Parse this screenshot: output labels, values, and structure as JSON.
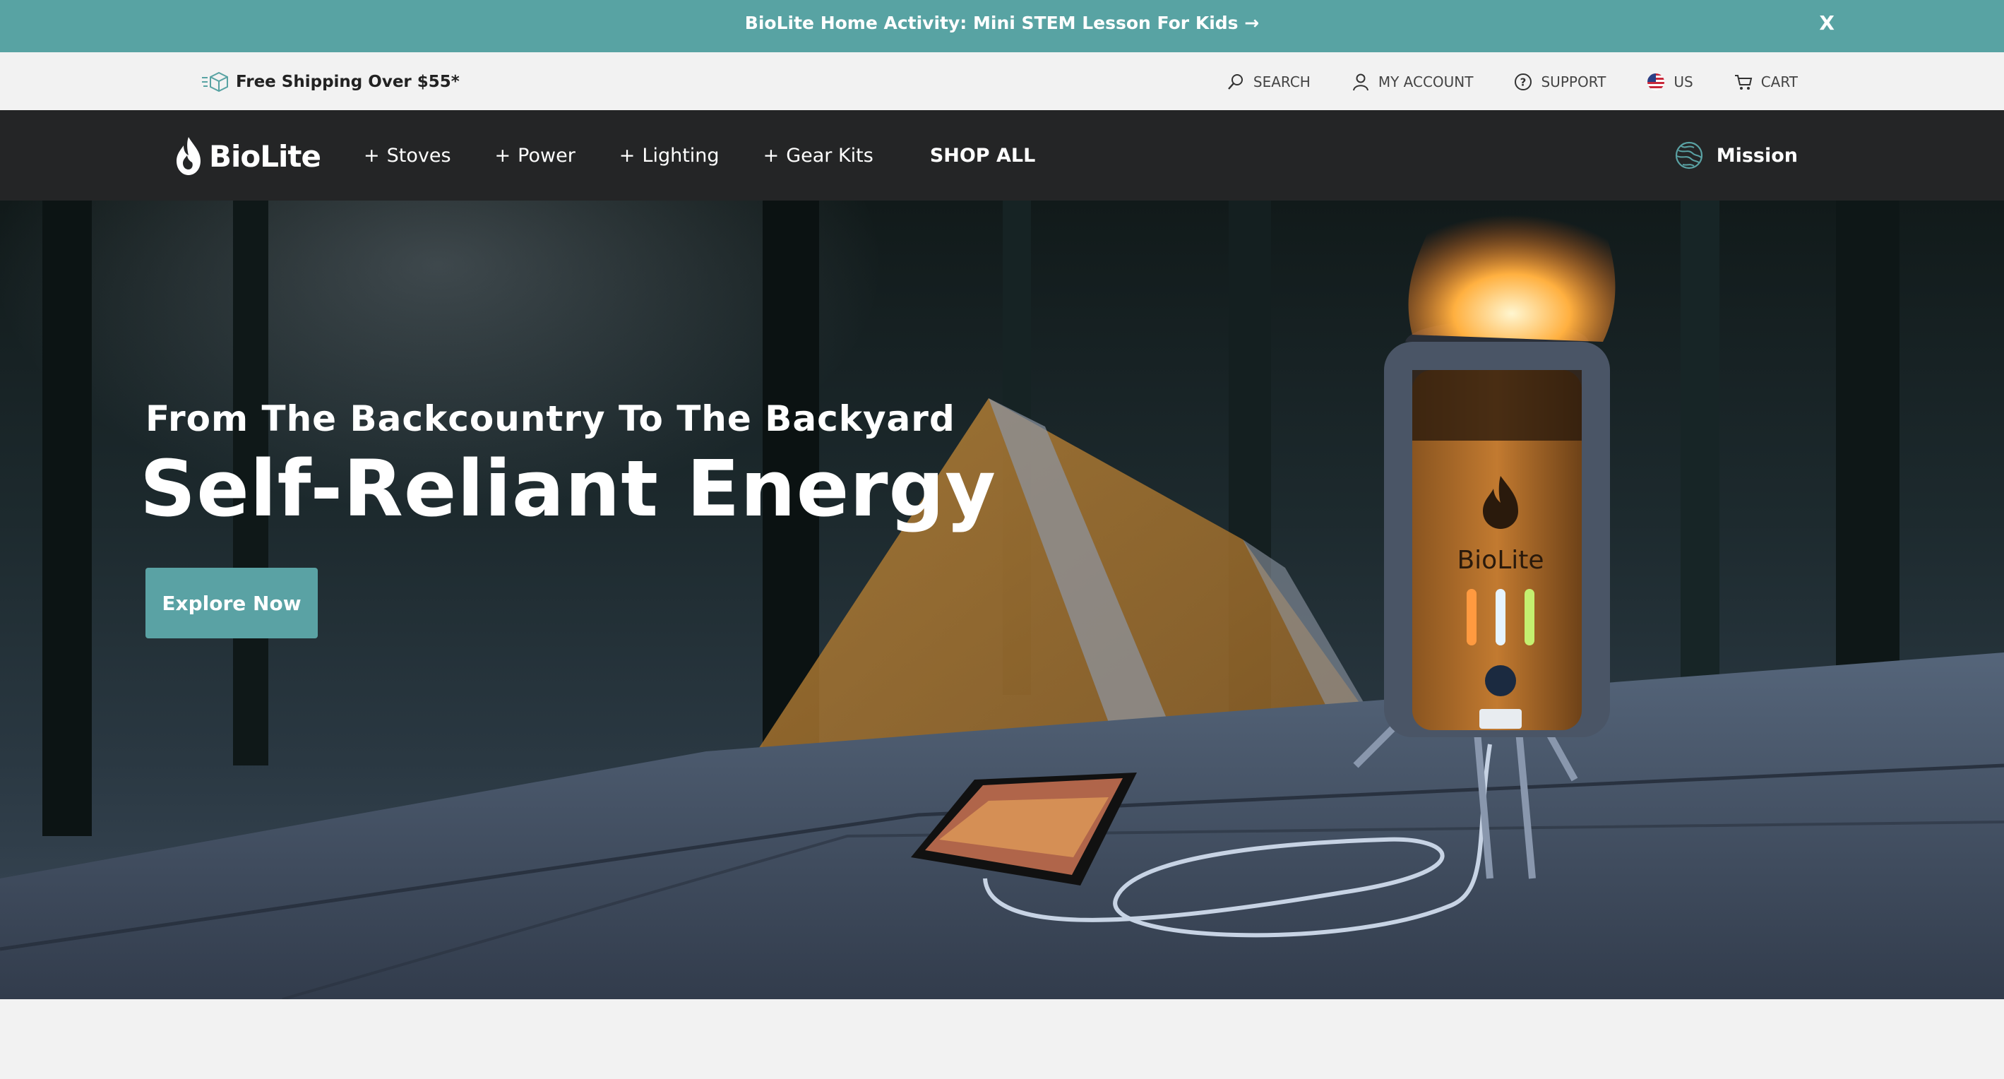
{
  "announcement": {
    "text": "BioLite Home Activity: Mini STEM Lesson For Kids →",
    "close_label": "X"
  },
  "utility": {
    "shipping_text": "Free Shipping Over $55*",
    "links": [
      {
        "label": "SEARCH",
        "icon": "search-icon"
      },
      {
        "label": "MY ACCOUNT",
        "icon": "user-icon"
      },
      {
        "label": "SUPPORT",
        "icon": "help-icon"
      },
      {
        "label": "US",
        "icon": "us-flag-icon"
      },
      {
        "label": "CART",
        "icon": "cart-icon"
      }
    ]
  },
  "nav": {
    "logo_text": "BioLite",
    "items": [
      {
        "prefix": "+",
        "label": "Stoves"
      },
      {
        "prefix": "+",
        "label": "Power"
      },
      {
        "prefix": "+",
        "label": "Lighting"
      },
      {
        "prefix": "+",
        "label": "Gear Kits"
      }
    ],
    "shop_all": "SHOP ALL",
    "mission": "Mission"
  },
  "hero": {
    "subtitle": "From The Backcountry To The Backyard",
    "title": "Self-Reliant Energy",
    "cta": "Explore Now",
    "stove_brand": "BioLite"
  },
  "colors": {
    "accent_teal": "#58a3a3",
    "nav_bg": "#242526",
    "utility_bg": "#f2f2f2"
  }
}
